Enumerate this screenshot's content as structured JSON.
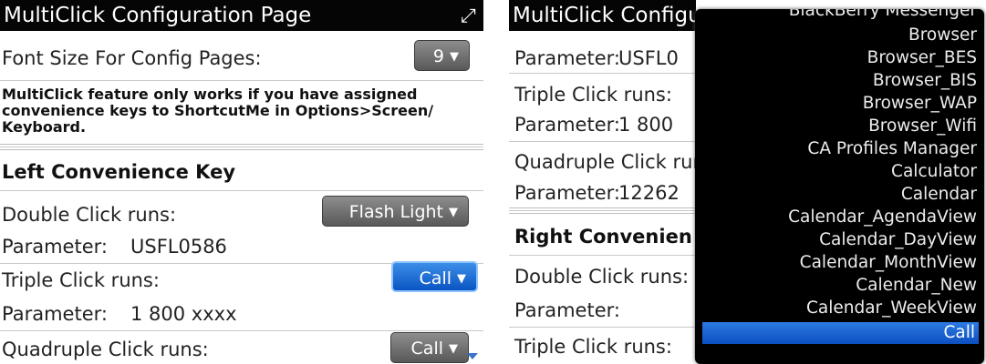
{
  "left": {
    "title": "MultiClick Configuration Page",
    "expand_icon": "expand-arrow-icon",
    "font_size_label": "Font Size For Config Pages:",
    "font_size_value": "9",
    "notice": "MultiClick feature only works if you have assigned convenience keys to ShortcutMe in Options>Screen/ Keyboard.",
    "section_left": "Left Convenience Key",
    "double_label": "Double Click runs:",
    "double_value": "Flash Light",
    "param1_label": "Parameter:",
    "param1_value": "USFL0586",
    "triple_label": "Triple Click runs:",
    "triple_value": "Call",
    "param2_label": "Parameter:",
    "param2_value": "1 800 xxxx",
    "quad_label": "Quadruple Click runs:",
    "quad_value": "Call"
  },
  "right": {
    "title": "MultiClick Configu",
    "param1_label": "Parameter:",
    "param1_value": "USFL0",
    "triple_label": "Triple Click runs:",
    "param2_label": "Parameter:",
    "param2_value": "1 800",
    "quad_label": "Quadruple Click run",
    "param3_label": "Parameter:",
    "param3_value": "12262",
    "section_right": "Right Convenien",
    "double_label": "Double Click runs:",
    "param4_label": "Parameter:",
    "triple2_label": "Triple Click runs:"
  },
  "dropdown": {
    "partial_top": "BlackBerry Messenger",
    "items": [
      "Browser",
      "Browser_BES",
      "Browser_BIS",
      "Browser_WAP",
      "Browser_Wifi",
      "CA Profiles Manager",
      "Calculator",
      "Calendar",
      "Calendar_AgendaView",
      "Calendar_DayView",
      "Calendar_MonthView",
      "Calendar_New",
      "Calendar_WeekView"
    ],
    "selected": "Call"
  },
  "colors": {
    "titlebar": "#050505",
    "selected_blue": "#0c4fbf",
    "button_grey": "#6e6e6e"
  }
}
